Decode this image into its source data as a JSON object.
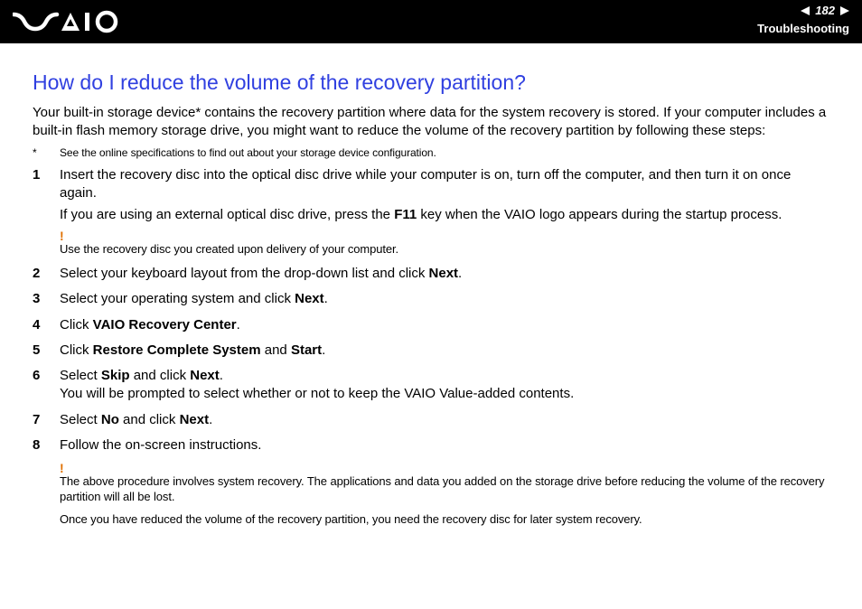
{
  "header": {
    "page_number": "182",
    "section": "Troubleshooting"
  },
  "title": "How do I reduce the volume of the recovery partition?",
  "intro": "Your built-in storage device* contains the recovery partition where data for the system recovery is stored. If your computer includes a built-in flash memory storage drive, you might want to reduce the volume of the recovery partition by following these steps:",
  "footnote_mark": "*",
  "footnote_text": "See the online specifications to find out about your storage device configuration.",
  "steps": {
    "s1_num": "1",
    "s1_a": "Insert the recovery disc into the optical disc drive while your computer is on, turn off the computer, and then turn it on once again.",
    "s1_b_pre": "If you are using an external optical disc drive, press the ",
    "s1_b_key": "F11",
    "s1_b_post": " key when the VAIO logo appears during the startup process.",
    "s1_note": "Use the recovery disc you created upon delivery of your computer.",
    "s2_num": "2",
    "s2_pre": "Select your keyboard layout from the drop-down list and click ",
    "s2_b": "Next",
    "s2_post": ".",
    "s3_num": "3",
    "s3_pre": "Select your operating system and click ",
    "s3_b": "Next",
    "s3_post": ".",
    "s4_num": "4",
    "s4_pre": "Click ",
    "s4_b": "VAIO Recovery Center",
    "s4_post": ".",
    "s5_num": "5",
    "s5_pre": "Click ",
    "s5_b1": "Restore Complete System",
    "s5_mid": " and ",
    "s5_b2": "Start",
    "s5_post": ".",
    "s6_num": "6",
    "s6_pre": "Select ",
    "s6_b1": "Skip",
    "s6_mid": " and click ",
    "s6_b2": "Next",
    "s6_post": ".",
    "s6_line2": "You will be prompted to select whether or not to keep the VAIO Value-added contents.",
    "s7_num": "7",
    "s7_pre": "Select ",
    "s7_b1": "No",
    "s7_mid": " and click ",
    "s7_b2": "Next",
    "s7_post": ".",
    "s8_num": "8",
    "s8_text": "Follow the on-screen instructions."
  },
  "warning": "The above procedure involves system recovery. The applications and data you added on the storage drive before reducing the volume of the recovery partition will all be lost.",
  "closing": "Once you have reduced the volume of the recovery partition, you need the recovery disc for later system recovery."
}
